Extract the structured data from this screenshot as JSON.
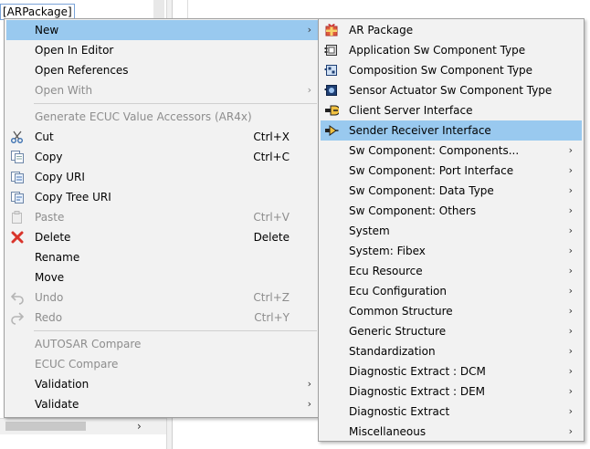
{
  "tree": {
    "selected_node": "[ARPackage]"
  },
  "context_menu": {
    "items": [
      {
        "label": "New",
        "icon": "",
        "arrow": true,
        "highlighted": true
      },
      {
        "label": "Open In Editor"
      },
      {
        "label": "Open References"
      },
      {
        "label": "Open With",
        "disabled": true,
        "arrow": true
      },
      {
        "label": "Generate ECUC Value Accessors (AR4x)",
        "disabled": true
      },
      {
        "label": "Cut",
        "icon": "scissors-icon",
        "shortcut": "Ctrl+X"
      },
      {
        "label": "Copy",
        "icon": "copy-icon",
        "shortcut": "Ctrl+C"
      },
      {
        "label": "Copy URI",
        "icon": "copy-uri-icon"
      },
      {
        "label": "Copy Tree URI",
        "icon": "copy-tree-uri-icon"
      },
      {
        "label": "Paste",
        "icon": "paste-icon",
        "shortcut": "Ctrl+V",
        "disabled": true
      },
      {
        "label": "Delete",
        "icon": "delete-x-icon",
        "shortcut": "Delete"
      },
      {
        "label": "Rename"
      },
      {
        "label": "Move"
      },
      {
        "label": "Undo",
        "icon": "undo-icon",
        "shortcut": "Ctrl+Z",
        "disabled": true
      },
      {
        "label": "Redo",
        "icon": "redo-icon",
        "shortcut": "Ctrl+Y",
        "disabled": true
      },
      {
        "label": "AUTOSAR Compare",
        "disabled": true
      },
      {
        "label": "ECUC Compare",
        "disabled": true
      },
      {
        "label": "Validation",
        "arrow": true
      },
      {
        "label": "Validate",
        "arrow": true
      }
    ]
  },
  "submenu": {
    "items": [
      {
        "label": "AR Package",
        "icon": "ar-package-icon"
      },
      {
        "label": "Application Sw Component Type",
        "icon": "component-type-icon"
      },
      {
        "label": "Composition Sw Component Type",
        "icon": "composition-type-icon"
      },
      {
        "label": "Sensor Actuator Sw Component Type",
        "icon": "sensor-actuator-icon"
      },
      {
        "label": "Client Server Interface",
        "icon": "client-server-interface-icon"
      },
      {
        "label": "Sender Receiver Interface",
        "icon": "sender-receiver-interface-icon",
        "highlighted": true
      },
      {
        "label": "Sw Component: Components...",
        "arrow": true
      },
      {
        "label": "Sw Component: Port Interface",
        "arrow": true
      },
      {
        "label": "Sw Component: Data Type",
        "arrow": true
      },
      {
        "label": "Sw Component: Others",
        "arrow": true
      },
      {
        "label": "System",
        "arrow": true
      },
      {
        "label": "System: Fibex",
        "arrow": true
      },
      {
        "label": "Ecu Resource",
        "arrow": true
      },
      {
        "label": "Ecu Configuration",
        "arrow": true
      },
      {
        "label": "Common Structure",
        "arrow": true
      },
      {
        "label": "Generic Structure",
        "arrow": true
      },
      {
        "label": "Standardization",
        "arrow": true
      },
      {
        "label": "Diagnostic Extract : DCM",
        "arrow": true
      },
      {
        "label": "Diagnostic Extract : DEM",
        "arrow": true
      },
      {
        "label": "Diagnostic Extract",
        "arrow": true
      },
      {
        "label": "Miscellaneous",
        "arrow": true
      }
    ]
  },
  "colors": {
    "highlight": "#99c9ef",
    "menu_bg": "#f2f2f2",
    "disabled_text": "#8d8d8d",
    "delete_red": "#d9342b"
  },
  "glyphs": {
    "arrow": "›",
    "scroll_right": "›"
  }
}
